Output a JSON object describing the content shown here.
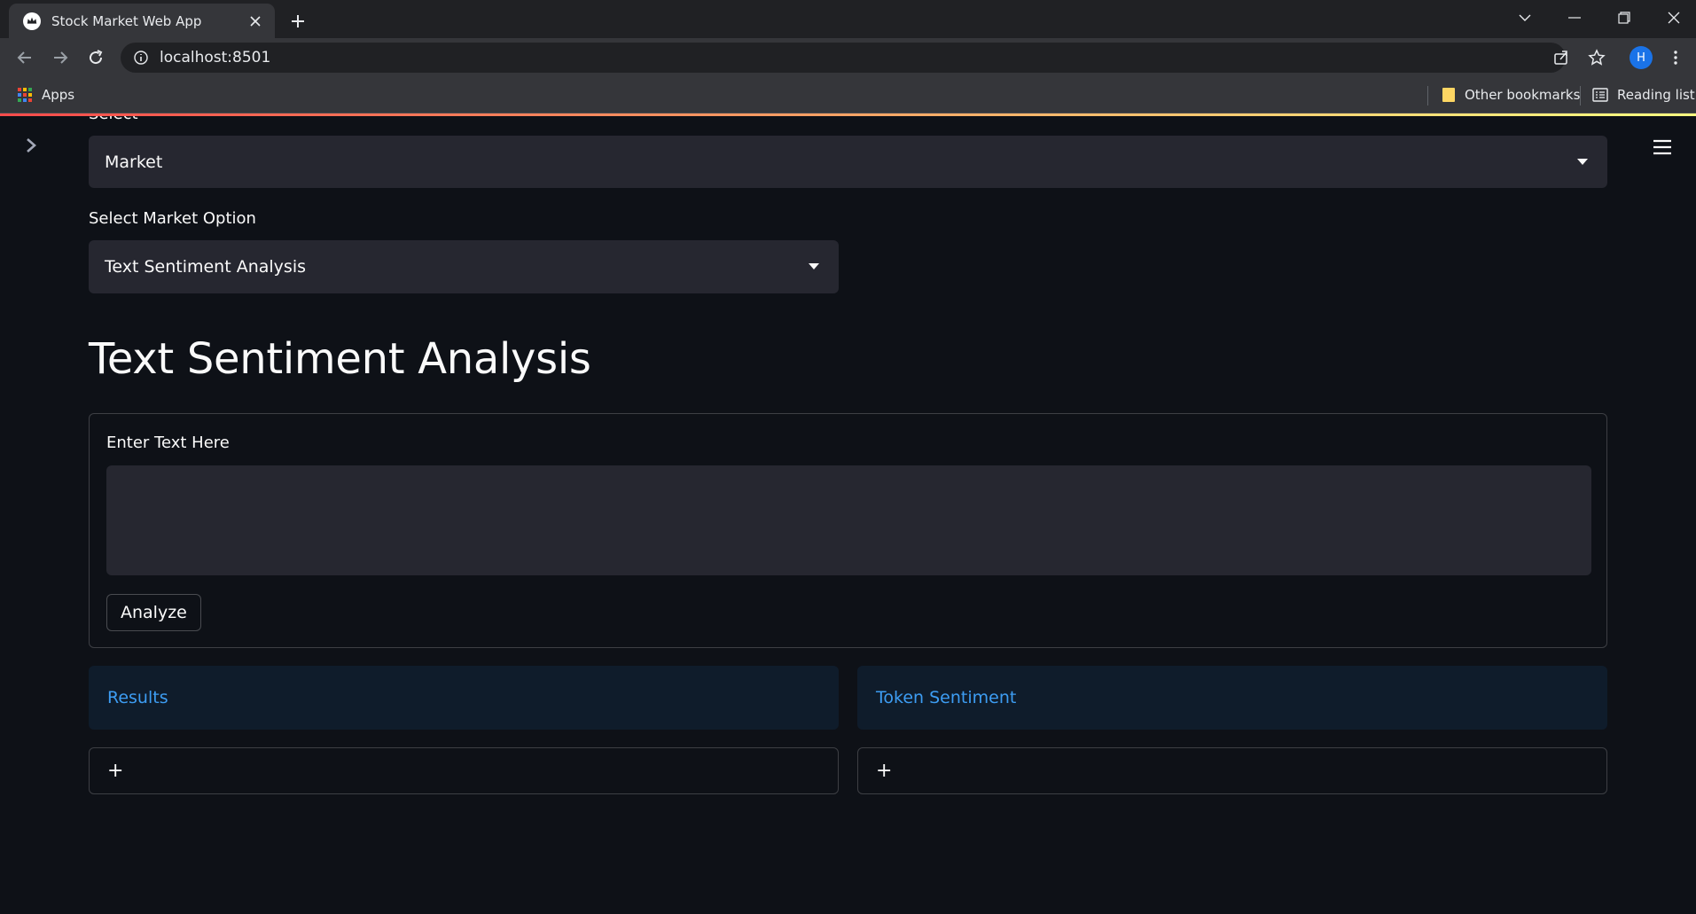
{
  "browser": {
    "tab_title": "Stock Market Web App",
    "url": "localhost:8501",
    "avatar_initial": "H",
    "bookmarks": {
      "apps_label": "Apps",
      "other_bookmarks_label": "Other bookmarks",
      "reading_list_label": "Reading list"
    }
  },
  "app": {
    "select_label": "Select",
    "select_value": "Market",
    "market_option_label": "Select Market Option",
    "market_option_value": "Text Sentiment Analysis",
    "page_title": "Text Sentiment Analysis",
    "form": {
      "text_label": "Enter Text Here",
      "text_value": "",
      "analyze_button": "Analyze"
    },
    "results_label": "Results",
    "token_sentiment_label": "Token Sentiment",
    "expander_symbol": "+"
  },
  "colors": {
    "background": "#0e1117",
    "widget_bg": "#262730",
    "info_text": "#3d9df3",
    "decoration_start": "#ff4b4b",
    "decoration_end": "#fffd80"
  },
  "icons": [
    "streamlit-crown-icon",
    "close-icon",
    "plus-icon",
    "back-arrow-icon",
    "forward-arrow-icon",
    "reload-icon",
    "info-icon",
    "share-icon",
    "star-icon",
    "kebab-menu-icon",
    "apps-grid-icon",
    "folder-icon",
    "reading-list-icon",
    "chevron-right-icon",
    "hamburger-menu-icon",
    "caret-down-icon"
  ]
}
